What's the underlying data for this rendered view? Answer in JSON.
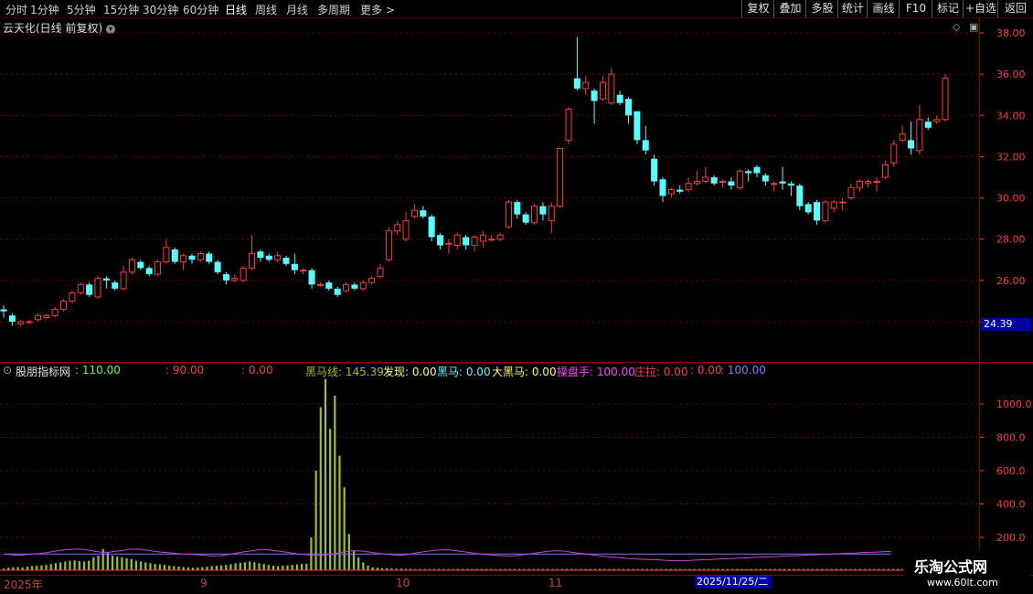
{
  "toolbar": {
    "periods": [
      "分时",
      "1分钟",
      "5分钟",
      "15分钟",
      "30分钟",
      "60分钟",
      "日线",
      "周线",
      "月线",
      "多周期",
      "更多 >"
    ],
    "tools": [
      "复权",
      "叠加",
      "多股",
      "统计",
      "画线",
      "F10",
      "标记",
      "+自选",
      "返回"
    ]
  },
  "chart_title": "云天化(日线 前复权)",
  "title_icon": "chevron-down-icon",
  "current_price": "24.39",
  "indicator": {
    "name": "股朋指标网",
    "v1": ": 110.00",
    "v2": ": 90.00",
    "v3": ": 0.00",
    "heima_line": "黑马线: 145.39",
    "faxian": "发现: 0.00",
    "heima": "黑马: 0.00",
    "daheima": "大黑马: 0.00",
    "caopanshou": "操盘手: 100.00",
    "zhuangla": "庄拉: 0.00",
    "v4": ": 0.00",
    "v5": ": 100.00"
  },
  "x_labels": [
    "2025年",
    "9",
    "10",
    "11"
  ],
  "x_cursor_label": "2025/11/25/二",
  "watermark": {
    "title": "乐淘公式网",
    "url": "www.60lt.com"
  },
  "colors": {
    "up": "#ff3b3b",
    "down": "#54ffff",
    "volume": "#a0c020",
    "line1": "#d040d0",
    "line2": "#6a7aff"
  },
  "chart_data": [
    {
      "type": "candlestick",
      "title": "云天化(日线 前复权)",
      "y_ticks": [
        24.0,
        26.0,
        28.0,
        30.0,
        32.0,
        34.0,
        36.0,
        38.0
      ],
      "ylim": [
        23.0,
        38.5
      ],
      "candles": [
        [
          24.6,
          24.5,
          24.8,
          24.2
        ],
        [
          24.3,
          24.0,
          24.4,
          23.8
        ],
        [
          23.9,
          24.0,
          24.1,
          23.8
        ],
        [
          24.0,
          24.0,
          24.1,
          23.9
        ],
        [
          24.1,
          24.3,
          24.4,
          24.0
        ],
        [
          24.2,
          24.3,
          24.4,
          24.1
        ],
        [
          24.3,
          24.6,
          24.7,
          24.2
        ],
        [
          24.6,
          25.0,
          25.1,
          24.5
        ],
        [
          25.0,
          25.4,
          25.5,
          24.9
        ],
        [
          25.4,
          25.8,
          25.9,
          25.3
        ],
        [
          25.8,
          25.3,
          25.9,
          25.2
        ],
        [
          25.2,
          26.1,
          26.2,
          25.1
        ],
        [
          26.1,
          26.0,
          26.2,
          25.6
        ],
        [
          25.9,
          25.6,
          26.0,
          25.5
        ],
        [
          25.6,
          26.4,
          26.7,
          25.5
        ],
        [
          26.4,
          27.0,
          27.1,
          26.3
        ],
        [
          26.9,
          26.6,
          27.0,
          26.5
        ],
        [
          26.6,
          26.3,
          26.7,
          26.2
        ],
        [
          26.3,
          26.9,
          27.0,
          26.2
        ],
        [
          26.9,
          27.6,
          28.0,
          26.8
        ],
        [
          27.5,
          26.9,
          27.6,
          26.8
        ],
        [
          26.9,
          27.2,
          27.3,
          26.5
        ],
        [
          27.2,
          27.0,
          27.3,
          26.8
        ],
        [
          27.0,
          27.3,
          27.4,
          26.9
        ],
        [
          27.3,
          26.9,
          27.4,
          26.8
        ],
        [
          26.9,
          26.4,
          27.0,
          26.3
        ],
        [
          26.3,
          26.0,
          26.4,
          25.8
        ],
        [
          26.0,
          26.1,
          26.3,
          25.9
        ],
        [
          26.0,
          26.6,
          26.7,
          25.9
        ],
        [
          26.6,
          27.3,
          28.2,
          26.5
        ],
        [
          27.4,
          27.1,
          27.5,
          26.9
        ],
        [
          27.2,
          27.0,
          27.3,
          26.9
        ],
        [
          27.0,
          27.2,
          27.4,
          26.9
        ],
        [
          27.1,
          26.8,
          27.2,
          26.7
        ],
        [
          26.8,
          26.5,
          27.3,
          26.3
        ],
        [
          26.5,
          26.5,
          26.6,
          26.3
        ],
        [
          26.5,
          25.8,
          26.6,
          25.6
        ],
        [
          25.8,
          25.8,
          25.9,
          25.7
        ],
        [
          25.9,
          25.6,
          26.0,
          25.5
        ],
        [
          25.6,
          25.3,
          25.7,
          25.2
        ],
        [
          25.5,
          25.8,
          25.9,
          25.4
        ],
        [
          25.8,
          25.6,
          25.9,
          25.5
        ],
        [
          25.6,
          25.9,
          26.0,
          25.5
        ],
        [
          25.9,
          26.1,
          26.2,
          25.8
        ],
        [
          26.2,
          26.6,
          26.8,
          26.1
        ],
        [
          27.0,
          28.4,
          28.6,
          26.9
        ],
        [
          28.4,
          28.7,
          28.9,
          28.2
        ],
        [
          28.0,
          28.9,
          29.3,
          27.9
        ],
        [
          29.1,
          29.4,
          29.7,
          29.0
        ],
        [
          29.4,
          29.1,
          29.6,
          29.0
        ],
        [
          29.1,
          28.1,
          29.2,
          27.9
        ],
        [
          28.2,
          27.7,
          28.3,
          27.5
        ],
        [
          27.8,
          27.8,
          28.0,
          27.3
        ],
        [
          27.7,
          28.2,
          28.3,
          27.5
        ],
        [
          28.1,
          27.7,
          28.2,
          27.5
        ],
        [
          27.7,
          28.1,
          28.2,
          27.4
        ],
        [
          27.9,
          28.2,
          28.4,
          27.6
        ],
        [
          28.0,
          28.0,
          28.2,
          27.9
        ],
        [
          28.0,
          28.2,
          28.3,
          27.9
        ],
        [
          28.6,
          29.8,
          29.9,
          28.5
        ],
        [
          29.8,
          29.2,
          29.9,
          29.0
        ],
        [
          29.2,
          28.8,
          29.3,
          28.7
        ],
        [
          28.8,
          29.6,
          29.7,
          28.7
        ],
        [
          29.6,
          29.2,
          29.8,
          28.9
        ],
        [
          28.9,
          29.6,
          29.8,
          28.3
        ],
        [
          29.6,
          32.4,
          32.4,
          29.5
        ],
        [
          32.8,
          34.3,
          34.4,
          32.6
        ],
        [
          35.8,
          35.3,
          37.8,
          35.2
        ],
        [
          35.3,
          35.6,
          35.9,
          35.0
        ],
        [
          35.2,
          34.7,
          35.3,
          33.6
        ],
        [
          34.8,
          35.6,
          35.9,
          34.7
        ],
        [
          34.6,
          36.0,
          36.3,
          34.5
        ],
        [
          35.0,
          34.6,
          35.2,
          34.5
        ],
        [
          34.8,
          34.0,
          34.9,
          33.6
        ],
        [
          34.2,
          32.8,
          34.2,
          32.6
        ],
        [
          32.8,
          32.3,
          33.5,
          32.1
        ],
        [
          31.9,
          30.8,
          32.1,
          30.6
        ],
        [
          30.9,
          30.1,
          31.0,
          29.8
        ],
        [
          30.2,
          30.4,
          30.5,
          30.0
        ],
        [
          30.4,
          30.3,
          30.6,
          30.2
        ],
        [
          30.4,
          30.7,
          31.0,
          30.3
        ],
        [
          30.7,
          30.8,
          31.3,
          30.6
        ],
        [
          30.8,
          31.0,
          31.5,
          30.7
        ],
        [
          31.0,
          30.7,
          31.1,
          30.6
        ],
        [
          30.8,
          30.8,
          30.9,
          30.5
        ],
        [
          30.8,
          30.6,
          31.0,
          30.4
        ],
        [
          30.5,
          31.3,
          31.4,
          30.4
        ],
        [
          31.3,
          31.2,
          31.4,
          30.8
        ],
        [
          31.5,
          31.2,
          31.6,
          31.0
        ],
        [
          31.1,
          30.8,
          31.2,
          30.6
        ],
        [
          30.7,
          30.7,
          30.8,
          30.3
        ],
        [
          30.8,
          30.7,
          31.5,
          30.4
        ],
        [
          30.7,
          30.6,
          30.8,
          30.1
        ],
        [
          30.6,
          29.6,
          30.7,
          29.4
        ],
        [
          29.7,
          29.3,
          29.8,
          29.2
        ],
        [
          29.8,
          28.9,
          29.9,
          28.7
        ],
        [
          28.9,
          29.8,
          29.9,
          28.8
        ],
        [
          29.5,
          29.8,
          29.9,
          29.3
        ],
        [
          29.8,
          29.8,
          30.0,
          29.4
        ],
        [
          30.0,
          30.5,
          30.7,
          29.9
        ],
        [
          30.5,
          30.8,
          30.9,
          30.3
        ],
        [
          30.7,
          30.8,
          30.9,
          30.5
        ],
        [
          30.8,
          30.8,
          31.0,
          30.3
        ],
        [
          31.0,
          31.6,
          31.8,
          30.9
        ],
        [
          31.7,
          32.6,
          32.8,
          31.5
        ],
        [
          32.8,
          33.1,
          33.5,
          32.7
        ],
        [
          32.8,
          32.4,
          33.7,
          32.1
        ],
        [
          32.3,
          33.8,
          34.5,
          32.1
        ],
        [
          33.7,
          33.4,
          33.9,
          33.3
        ],
        [
          33.7,
          33.8,
          34.0,
          33.6
        ],
        [
          33.8,
          35.8,
          36.0,
          33.7
        ]
      ]
    },
    {
      "type": "bar",
      "title": "股朋指标网",
      "y_ticks": [
        200.0,
        400.0,
        600.0,
        800.0,
        1000.0
      ],
      "ylim": [
        0,
        1200
      ],
      "volume_bars": [
        12,
        18,
        20,
        22,
        20,
        25,
        28,
        30,
        32,
        35,
        40,
        45,
        50,
        55,
        60,
        62,
        58,
        55,
        60,
        80,
        90,
        130,
        110,
        90,
        85,
        80,
        75,
        70,
        60,
        55,
        50,
        45,
        40,
        38,
        35,
        30,
        28,
        25,
        22,
        20,
        18,
        20,
        22,
        25,
        28,
        30,
        32,
        35,
        40,
        45,
        48,
        50,
        55,
        50,
        45,
        40,
        35,
        30,
        28,
        30,
        32,
        35,
        38,
        40,
        42,
        200,
        600,
        980,
        1150,
        850,
        1050,
        690,
        500,
        220,
        120,
        80,
        50,
        30,
        20,
        18,
        15,
        14,
        13,
        12,
        12,
        11,
        11,
        10,
        10,
        10,
        10,
        10,
        10,
        10,
        10,
        10,
        10,
        10,
        10,
        10,
        10,
        10,
        10,
        10,
        10,
        10,
        10,
        10,
        10,
        10,
        10,
        10,
        10,
        10,
        10,
        10,
        10,
        10,
        10,
        10,
        10,
        10,
        10,
        10,
        10,
        10,
        10,
        10,
        10,
        10,
        10,
        10,
        10,
        10,
        10,
        10,
        10,
        10,
        10,
        10,
        10,
        10,
        10,
        10,
        10,
        10,
        10,
        10,
        10,
        10,
        10,
        10,
        10,
        10,
        10,
        10,
        10,
        10,
        10,
        10,
        10,
        10,
        10,
        10,
        10,
        10,
        10,
        10,
        10,
        10,
        10,
        10,
        10,
        10,
        10,
        10,
        10,
        10,
        10,
        10,
        10,
        10,
        10,
        10,
        10,
        10,
        10,
        10,
        10,
        10,
        10,
        10,
        10,
        10,
        10,
        10,
        10,
        10,
        10,
        40
      ],
      "line1": [
        100,
        96,
        92,
        96,
        100,
        104,
        110,
        118,
        124,
        128,
        130,
        126,
        118,
        112,
        110,
        116,
        122,
        128,
        130,
        124,
        118,
        112,
        108,
        104,
        100,
        98,
        96,
        92,
        88,
        90,
        96,
        104,
        112,
        118,
        124,
        128,
        122,
        116,
        110,
        104,
        98,
        94,
        90,
        94,
        100,
        108,
        116,
        120,
        118,
        112,
        106,
        100,
        96,
        92,
        96,
        104,
        112,
        118,
        122,
        126,
        124,
        118,
        112,
        106,
        100,
        96,
        92,
        90,
        88,
        92,
        98,
        104,
        110,
        116,
        120,
        118,
        112,
        106,
        100,
        94,
        88,
        84,
        80,
        76,
        72,
        70,
        68,
        66,
        64,
        62,
        60,
        60,
        62,
        64,
        66,
        68,
        70,
        72,
        74,
        76,
        78,
        80,
        82,
        84,
        86,
        88,
        90,
        92,
        94,
        96,
        98,
        100,
        102,
        104,
        106,
        108,
        110,
        112,
        114,
        116
      ],
      "line2_level": 100
    }
  ]
}
